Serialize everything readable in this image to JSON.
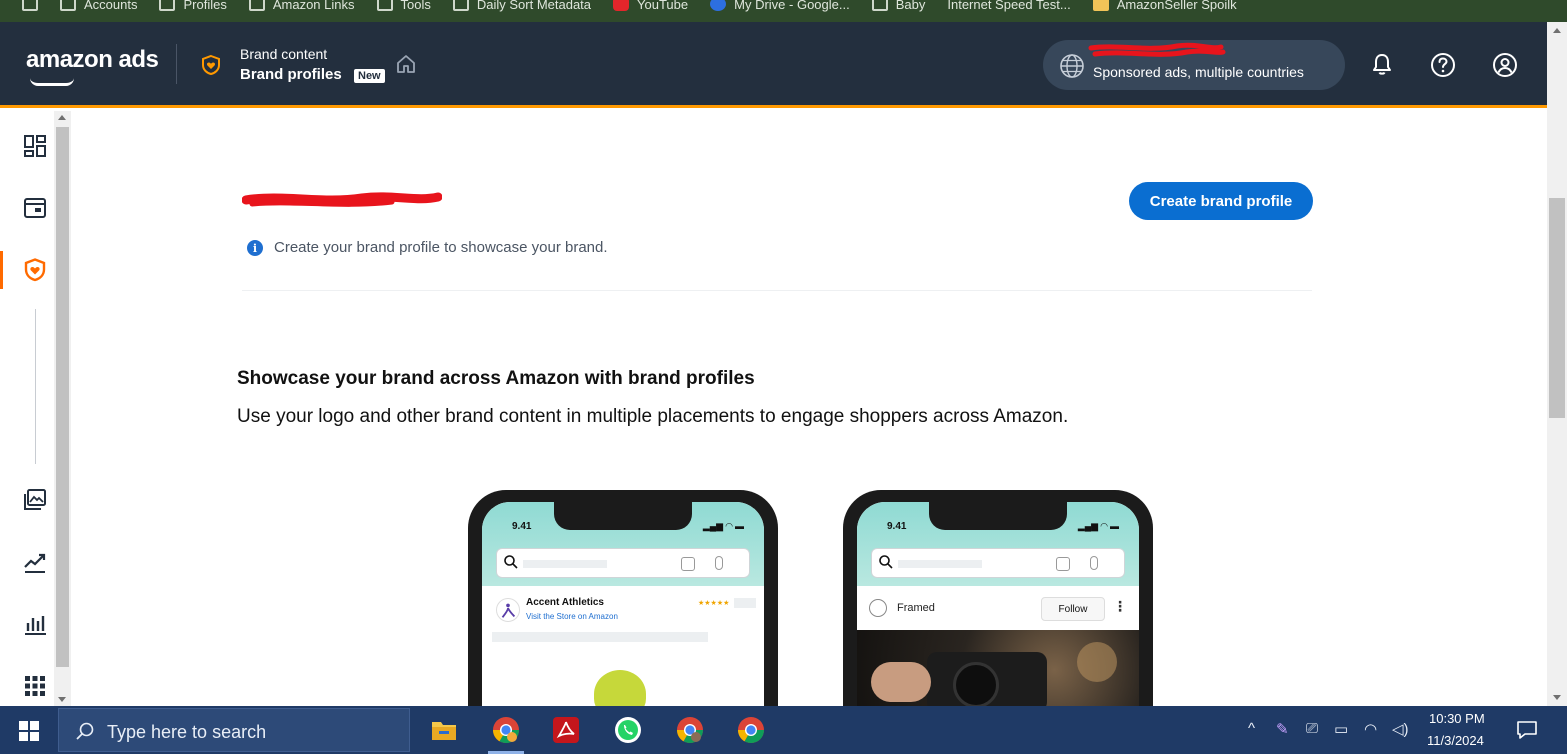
{
  "bookmarks": {
    "items": [
      "Accounts",
      "Profiles",
      "Amazon Links",
      "Tools",
      "Daily Sort Metadata",
      "YouTube",
      "My Drive - Google...",
      "Baby",
      "Internet Speed Test...",
      "AmazonSeller Spoilk"
    ]
  },
  "header": {
    "logo_text": "amazon ads",
    "breadcrumb_parent": "Brand content",
    "breadcrumb_current": "Brand profiles",
    "new_badge": "New",
    "account_subtitle": "Sponsored ads, multiple countries",
    "accent_color": "#ff9900",
    "background_color": "#232f3e"
  },
  "left_nav": {
    "icons": [
      "dashboard-icon",
      "campaigns-icon",
      "brand-shield-icon",
      "media-icon",
      "trends-icon",
      "reports-icon",
      "apps-grid-icon"
    ],
    "active": "brand-shield-icon"
  },
  "main": {
    "create_button_label": "Create brand profile",
    "info_message": "Create your brand profile to showcase your brand.",
    "section_title": "Showcase your brand across Amazon with brand profiles",
    "section_description": "Use your logo and other brand content in multiple placements to engage shoppers across Amazon."
  },
  "phones": [
    {
      "time": "9.41",
      "brand_name": "Accent Athletics",
      "brand_link": "Visit the Store on Amazon",
      "stars": "★★★★★"
    },
    {
      "time": "9.41",
      "brand_name": "Framed",
      "follow_label": "Follow"
    }
  ],
  "taskbar": {
    "search_placeholder": "Type here to search",
    "time": "10:30 PM",
    "date": "11/3/2024"
  }
}
